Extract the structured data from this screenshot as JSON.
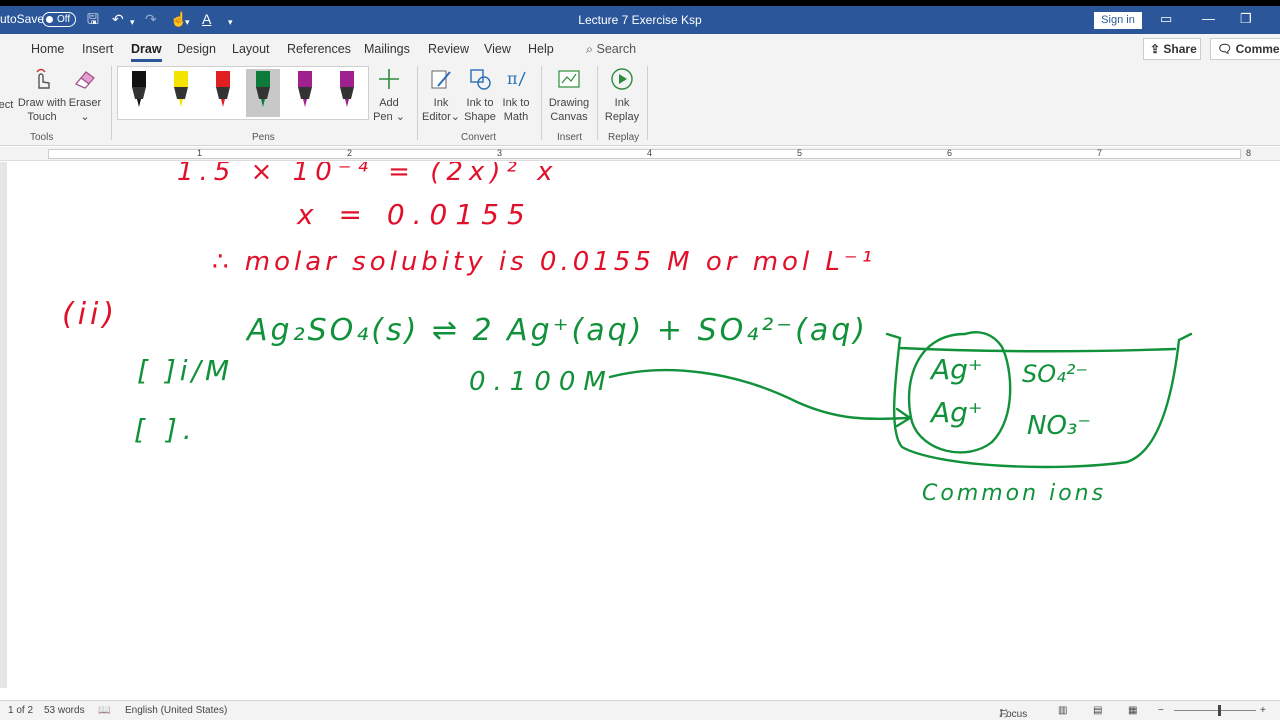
{
  "titlebar": {
    "autosave_label": "utoSave",
    "autosave_state": "Off",
    "document_title": "Lecture 7 Exercise Ksp",
    "sign_in": "Sign in"
  },
  "tabs": [
    "Home",
    "Insert",
    "Draw",
    "Design",
    "Layout",
    "References",
    "Mailings",
    "Review",
    "View",
    "Help"
  ],
  "active_tab": "Draw",
  "search_label": "Search",
  "share_label": "Share",
  "comments_label": "Comments",
  "ribbon": {
    "tools": {
      "select": "ect",
      "draw_touch_line1": "Draw with",
      "draw_touch_line2": "Touch",
      "eraser": "Eraser",
      "group": "Tools"
    },
    "pens_group": "Pens",
    "pen_colors": [
      "#111111",
      "#f5e400",
      "#e02020",
      "#0e7a3a",
      "#a0208f",
      "#a0208f"
    ],
    "add_pen_line1": "Add",
    "add_pen_line2": "Pen",
    "convert": {
      "ink_editor_line1": "Ink",
      "ink_editor_line2": "Editor",
      "ink_shape_line1": "Ink to",
      "ink_shape_line2": "Shape",
      "ink_math_line1": "Ink to",
      "ink_math_line2": "Math",
      "group": "Convert"
    },
    "insert": {
      "canvas_line1": "Drawing",
      "canvas_line2": "Canvas",
      "group": "Insert"
    },
    "replay": {
      "line1": "Ink",
      "line2": "Replay",
      "group": "Replay"
    }
  },
  "ruler_numbers": [
    "1",
    "2",
    "3",
    "4",
    "5",
    "6",
    "7",
    "8"
  ],
  "handwriting": {
    "red_line1": "1.5 × 10⁻⁴ = (2x)² x",
    "red_line2": "x = 0.0155",
    "red_line3": "∴ molar solubity is 0.0155 M or mol L⁻¹",
    "red_label": "(ii)",
    "green_equation": "Ag₂SO₄(s) ⇌ 2 Ag⁺(aq) + SO₄²⁻(aq)",
    "green_conc": "0.100M",
    "green_bracket1": "[ ]i/M",
    "green_bracket2": "[ ].",
    "box_ag1": "Ag⁺",
    "box_ag2": "Ag⁺",
    "box_so4": "SO₄²⁻",
    "box_no3": "NO₃⁻",
    "common_ions": "Common ions"
  },
  "ink_colors": {
    "red": "#e0102a",
    "green": "#11913a"
  },
  "status": {
    "page": "1 of 2",
    "words": "53 words",
    "language": "English (United States)",
    "focus": "Focus"
  }
}
